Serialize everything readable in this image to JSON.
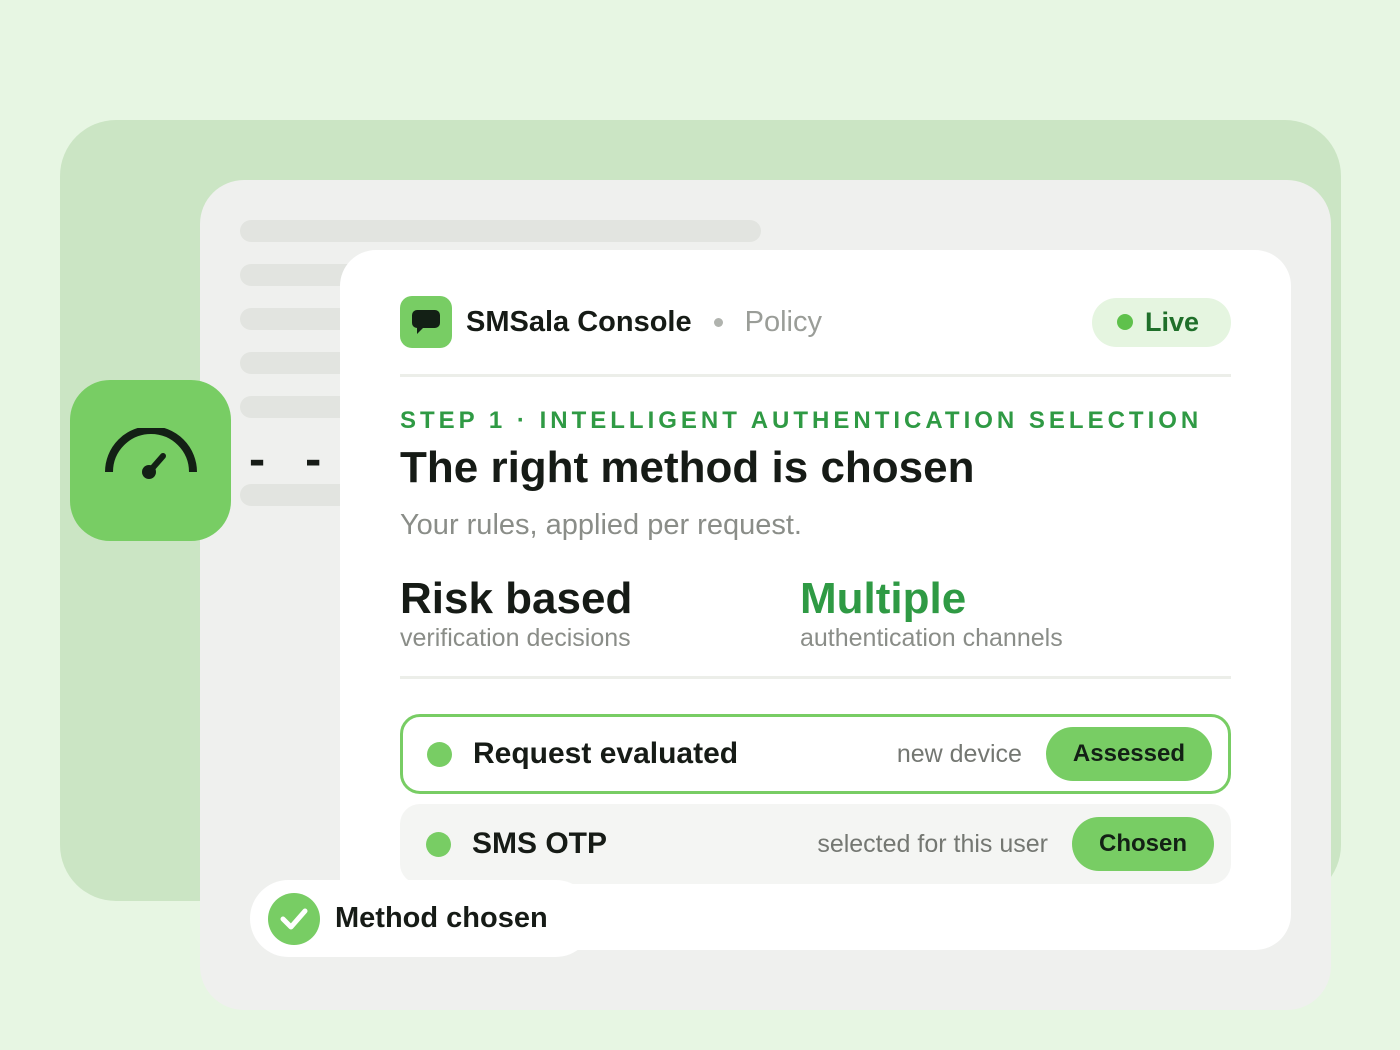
{
  "colors": {
    "background": "#e7f6e3",
    "back_panel": "#cbe5c4",
    "accent_green": "#78cd64",
    "text_green": "#2f9a44",
    "dark_text": "#161b16"
  },
  "gauge": {
    "icon": "speedometer-icon",
    "marks": "- -"
  },
  "header": {
    "app_icon": "chat-bubble-icon",
    "app_name": "SMSala Console",
    "section": "Policy",
    "status": "Live"
  },
  "step": {
    "label": "STEP 1 · INTELLIGENT AUTHENTICATION SELECTION",
    "title": "The right method is chosen",
    "subtitle": "Your rules, applied per request."
  },
  "stats": [
    {
      "value": "Risk based",
      "caption": "verification decisions"
    },
    {
      "value": "Multiple",
      "caption": "authentication channels"
    }
  ],
  "rows": [
    {
      "title": "Request evaluated",
      "meta": "new device",
      "badge": "Assessed"
    },
    {
      "title": "SMS OTP",
      "meta": "selected for this user",
      "badge": "Chosen"
    }
  ],
  "toast": {
    "icon": "checkmark-icon",
    "text": "Method chosen"
  }
}
